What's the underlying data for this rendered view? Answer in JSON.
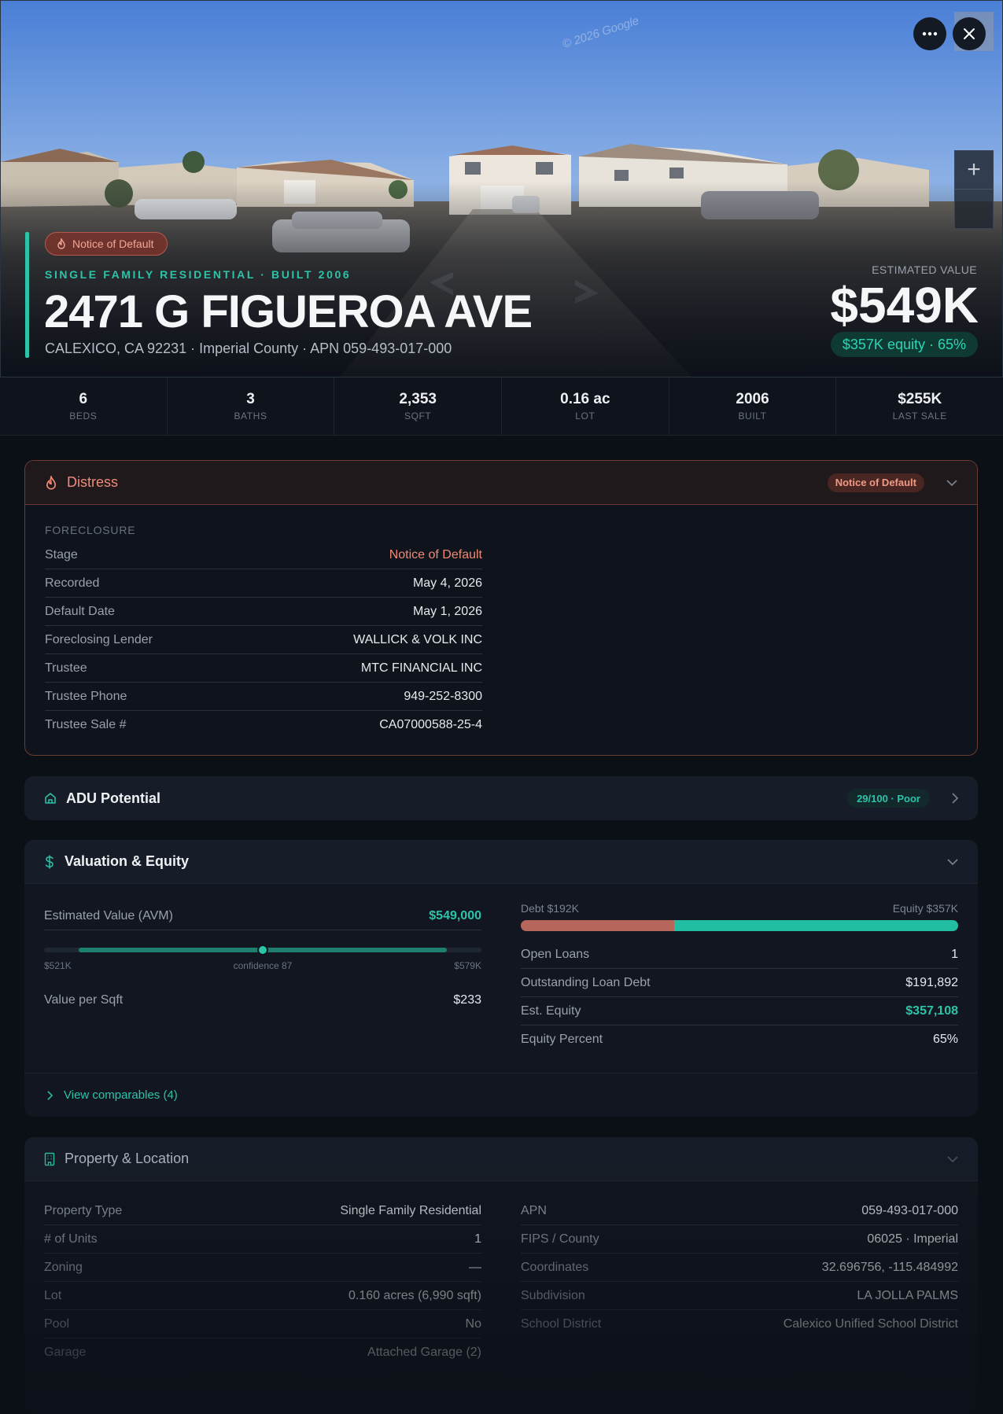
{
  "hero": {
    "watermark": "© 2026 Google",
    "status_pill": "Notice of Default",
    "kicker": "SINGLE FAMILY RESIDENTIAL · BUILT 2006",
    "address": "2471 G FIGUEROA AVE",
    "subline": "CALEXICO, CA 92231 · Imperial County · APN 059-493-017-000",
    "est_label": "ESTIMATED VALUE",
    "est_value": "$549K",
    "equity_pill": "$357K equity · 65%",
    "zoom_in": "+"
  },
  "stats": [
    {
      "value": "6",
      "label": "BEDS"
    },
    {
      "value": "3",
      "label": "BATHS"
    },
    {
      "value": "2,353",
      "label": "SQFT"
    },
    {
      "value": "0.16 ac",
      "label": "LOT"
    },
    {
      "value": "2006",
      "label": "BUILT"
    },
    {
      "value": "$255K",
      "label": "LAST SALE"
    }
  ],
  "distress": {
    "title": "Distress",
    "badge": "Notice of Default",
    "section": "FORECLOSURE",
    "rows": [
      {
        "k": "Stage",
        "v": "Notice of Default"
      },
      {
        "k": "Recorded",
        "v": "May 4, 2026"
      },
      {
        "k": "Default Date",
        "v": "May 1, 2026"
      },
      {
        "k": "Foreclosing Lender",
        "v": "WALLICK & VOLK INC"
      },
      {
        "k": "Trustee",
        "v": "MTC FINANCIAL INC"
      },
      {
        "k": "Trustee Phone",
        "v": "949-252-8300"
      },
      {
        "k": "Trustee Sale #",
        "v": "CA07000588-25-4"
      }
    ]
  },
  "adu": {
    "title": "ADU Potential",
    "badge": "29/100 · Poor"
  },
  "valuation": {
    "title": "Valuation & Equity",
    "avm_label": "Estimated Value (AVM)",
    "avm_value": "$549,000",
    "range_low": "$521K",
    "range_high": "$579K",
    "confidence": "confidence 87",
    "range_fill_start": 0.08,
    "range_fill_end": 0.92,
    "range_marker": 0.5,
    "vps_label": "Value per Sqft",
    "vps_value": "$233",
    "debt_label": "Debt $192K",
    "equity_label": "Equity $357K",
    "debt_fraction": 0.35,
    "rows": [
      {
        "k": "Open Loans",
        "v": "1"
      },
      {
        "k": "Outstanding Loan Debt",
        "v": "$191,892"
      },
      {
        "k": "Est. Equity",
        "v": "$357,108"
      },
      {
        "k": "Equity Percent",
        "v": "65%"
      }
    ],
    "comps_link": "View comparables (4)"
  },
  "property": {
    "title": "Property & Location",
    "left": [
      {
        "k": "Property Type",
        "v": "Single Family Residential"
      },
      {
        "k": "# of Units",
        "v": "1"
      },
      {
        "k": "Zoning",
        "v": "—"
      },
      {
        "k": "Lot",
        "v": "0.160 acres (6,990 sqft)"
      },
      {
        "k": "Pool",
        "v": "No"
      },
      {
        "k": "Garage",
        "v": "Attached Garage (2)"
      }
    ],
    "right": [
      {
        "k": "APN",
        "v": "059-493-017-000"
      },
      {
        "k": "FIPS / County",
        "v": "06025 · Imperial"
      },
      {
        "k": "Coordinates",
        "v": "32.696756, -115.484992"
      },
      {
        "k": "Subdivision",
        "v": "LA JOLLA PALMS"
      },
      {
        "k": "School District",
        "v": "Calexico Unified School District"
      }
    ]
  },
  "colors": {
    "accent": "#2bc4a8",
    "distress": "#f08a76",
    "debt": "#b7665b",
    "equity": "#22bea3"
  },
  "icons": [
    "more-horizontal-icon",
    "close-icon",
    "flame-icon",
    "chevron-down-icon",
    "home-icon",
    "chevron-right-icon",
    "dollar-icon",
    "building-icon"
  ]
}
